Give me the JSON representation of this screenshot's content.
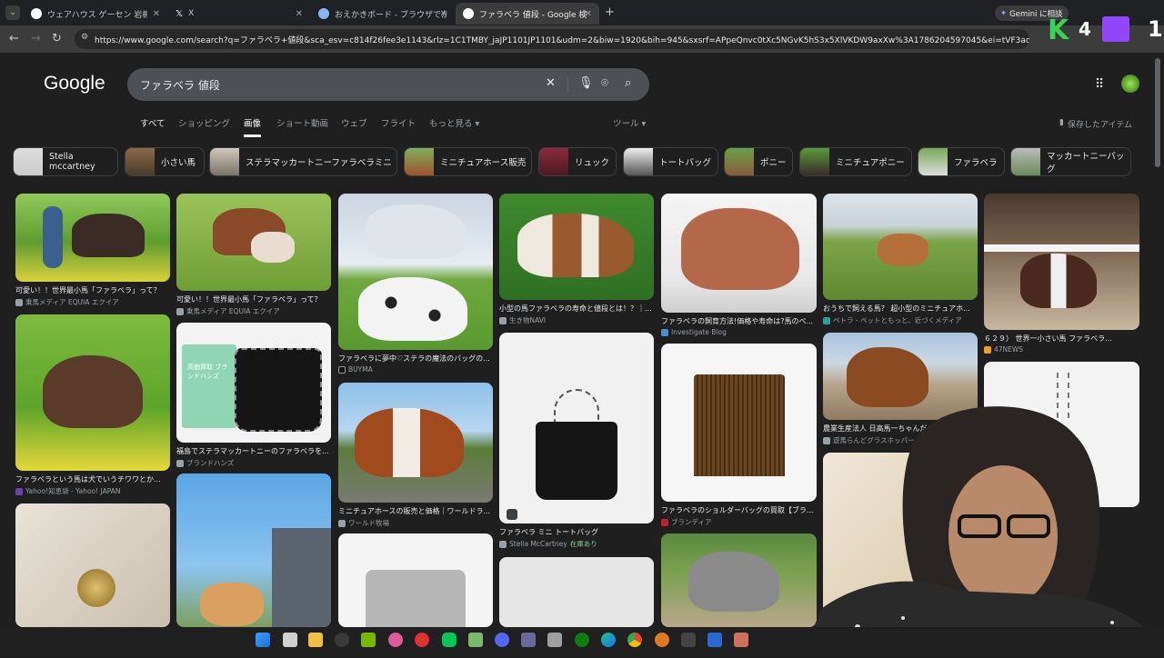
{
  "tabs": [
    {
      "title": "ウェアハウス ゲーセン 岩槻 - Google",
      "active": false
    },
    {
      "title": "X",
      "active": false
    },
    {
      "title": "おえかきボード - ブラウザでかんたん",
      "active": false
    },
    {
      "title": "ファラベラ 値段 - Google 検索",
      "active": true
    }
  ],
  "gemini_label": "Gemini に相談",
  "url": "https://www.google.com/search?q=ファラベラ+値段&sca_esv=c814f26fee3e1143&rlz=1C1TMBY_jaJP1101JP1101&udm=2&biw=1920&bih=945&sxsrf=APpeQnvc0tXc5NGvK5hS3x5XlVKDW9axXw%3A1786204597045&ei=tVF3aoOvAu29vr0Pn9WZ6A...",
  "logo": "Google",
  "search": {
    "query": "ファラベラ 値段"
  },
  "search_tabs": [
    "すべて",
    "ショッピング",
    "画像",
    "ショート動画",
    "ウェブ",
    "フライト",
    "もっと見る"
  ],
  "tools_label": "ツール",
  "saved_label": "保存したアイテム",
  "chips": [
    "Stella mccartney",
    "小さい馬",
    "ステラマッカートニーファラベラミニ",
    "ミニチュアホース販売",
    "リュック",
    "トートバッグ",
    "ポニー",
    "ミニチュアポニー",
    "ファラベラ",
    "マッカートニーバッグ"
  ],
  "results": {
    "r1": {
      "title": "可愛い！！世界最小馬「ファラベラ」って？",
      "source": "乗馬メディア EQUIA エクイア"
    },
    "r2": {
      "title": "ファラベラという馬は犬でいうチワワとか...",
      "source": "Yahoo!知恵袋 - Yahoo! JAPAN"
    },
    "r3": {
      "title": "可愛い！！世界最小馬「ファラベラ」って？",
      "source": "乗馬メディア EQUIA エクイア"
    },
    "r4": {
      "title": "福島でステラマッカートニーのファラベラを...",
      "source": "ブランドハンズ"
    },
    "r5": {
      "title": "ファラベラに夢中♡ステラの魔法のバッグの...",
      "source": "BUYMA"
    },
    "r6": {
      "title": "ミニチュアホースの販売と価格｜ワールドラ...",
      "source": "ワールド牧場"
    },
    "r7": {
      "title": "小型の馬ファラベラの寿命と値段とは！？｜...",
      "source": "生き物NAVI"
    },
    "r8": {
      "title": "ファラベラ ミニ トートバッグ",
      "source": "Stella McCartney",
      "stock": "在庫あり"
    },
    "r9": {
      "title": "ファラベラの飼育方法!価格や寿命は?馬のペ...",
      "source": "Investigate Blog"
    },
    "r10": {
      "title": "ファラベラのショルダーバッグの買取【ブラ...",
      "source": "ブランディア"
    },
    "r11": {
      "title": "おうちで飼える馬？ 超小型のミニチュアホ...",
      "source": "ペトラ - ペットともっと、近づくメディア"
    },
    "r12": {
      "title": "農業生産法人 日高馬一ちゃんだいず 株式会社",
      "source": "遊馬らんどグラスホッパー"
    },
    "r13": {
      "title": "６２９） 世界一小さい馬 ファラベラ...",
      "source": "47NEWS"
    }
  },
  "overlay_brand_text": "高価買取 ブランドハンズ",
  "stream_overlay": {
    "count_left": "4",
    "count_right": "1"
  },
  "colors": {
    "page_bg": "#1f1f1f",
    "chrome_bg": "#202124",
    "address_bg": "#3c3c3c",
    "search_bg": "#4d5156",
    "stock_green": "#81c995"
  }
}
